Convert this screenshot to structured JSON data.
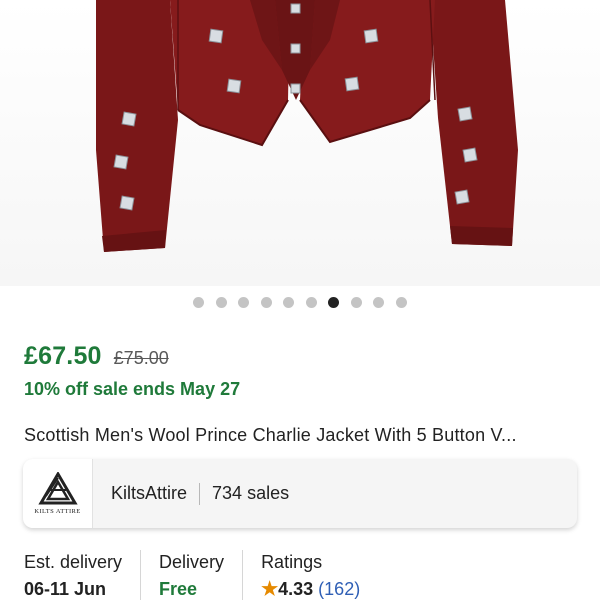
{
  "product_image": {
    "alt": "",
    "carousel": {
      "total": 10,
      "active_index": 6
    }
  },
  "colors": {
    "jacket": "#7a1718",
    "sale_green": "#1f7a3a",
    "star": "#e68a00",
    "link_blue": "#2f5fb5"
  },
  "price": {
    "current": "£67.50",
    "original": "£75.00",
    "sale_note": "10% off sale ends May 27"
  },
  "title": "Scottish Men's Wool Prince Charlie Jacket With 5 Button V...",
  "shop": {
    "logo_text": "KILTS ATTIRE",
    "name": "KiltsAttire",
    "sales": "734 sales",
    "logo_icon": "triangle-knot-icon"
  },
  "info": {
    "delivery_est": {
      "label": "Est. delivery",
      "value": "06-11 Jun"
    },
    "delivery": {
      "label": "Delivery",
      "value": "Free"
    },
    "ratings": {
      "label": "Ratings",
      "value": "4.33",
      "count": "(162)",
      "icon": "star-icon"
    }
  }
}
